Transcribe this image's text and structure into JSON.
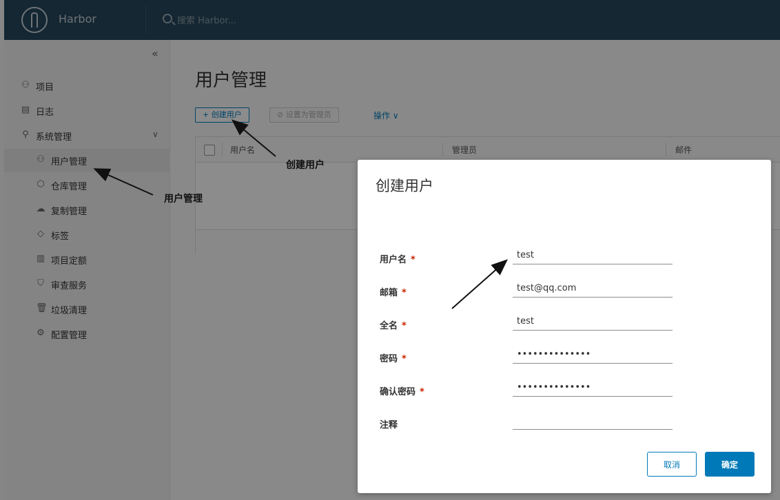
{
  "header": {
    "app_title": "Harbor",
    "search_placeholder": "搜索 Harbor..."
  },
  "sidebar": {
    "items": [
      {
        "label": "项目",
        "icon": "project-icon"
      },
      {
        "label": "日志",
        "icon": "log-icon"
      },
      {
        "label": "系统管理",
        "icon": "admin-icon"
      },
      {
        "label": "用户管理",
        "icon": "users-icon",
        "active": true
      },
      {
        "label": "仓库管理",
        "icon": "registry-icon"
      },
      {
        "label": "复制管理",
        "icon": "replication-icon"
      },
      {
        "label": "标签",
        "icon": "tag-icon"
      },
      {
        "label": "项目定额",
        "icon": "quota-icon"
      },
      {
        "label": "审查服务",
        "icon": "shield-icon"
      },
      {
        "label": "垃圾清理",
        "icon": "trash-icon"
      },
      {
        "label": "配置管理",
        "icon": "gear-icon"
      }
    ]
  },
  "main": {
    "page_title": "用户管理",
    "create_user_label": "创建用户",
    "set_admin_label": "设置为管理员",
    "actions_label": "操作",
    "grid_columns": [
      "用户名",
      "管理员",
      "邮件"
    ]
  },
  "modal": {
    "title": "创建用户",
    "fields": [
      {
        "label": "用户名",
        "required": true,
        "value": "test",
        "type": "text"
      },
      {
        "label": "邮箱",
        "required": true,
        "value": "test@qq.com",
        "type": "text"
      },
      {
        "label": "全名",
        "required": true,
        "value": "test",
        "type": "text"
      },
      {
        "label": "密码",
        "required": true,
        "value": "••••••••••••••",
        "type": "password"
      },
      {
        "label": "确认密码",
        "required": true,
        "value": "••••••••••••••",
        "type": "password"
      },
      {
        "label": "注释",
        "required": false,
        "value": "",
        "type": "text"
      }
    ],
    "cancel_label": "取消",
    "ok_label": "确定"
  },
  "annotations": {
    "create_user": "创建用户",
    "user_management": "用户管理"
  },
  "colors": {
    "header_bg": "#25475c",
    "primary": "#0079b8",
    "required": "#c92100"
  }
}
